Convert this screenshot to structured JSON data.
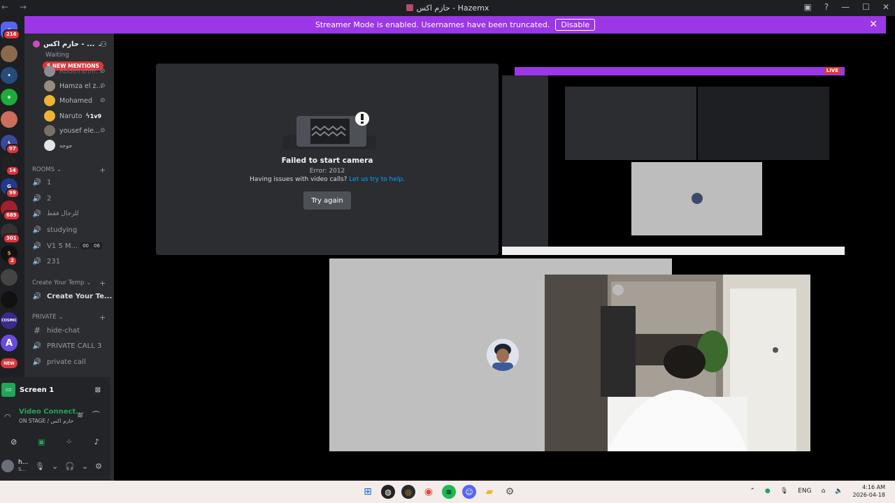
{
  "window": {
    "title": "حازم اكس - Hazemx",
    "nav": "← →"
  },
  "banner": {
    "text": "Streamer Mode is enabled. Usernames have been truncated.",
    "button": "Disable"
  },
  "guild_badges": [
    "216",
    "97",
    "14",
    "99",
    "689",
    "301",
    "2"
  ],
  "guild_labels": {
    "cosmic": "COSMIC",
    "new": "NEW",
    "a": "A",
    "num": "5"
  },
  "server": {
    "name": "حازم اكس - ...",
    "mentions": "5 NEW MENTIONS",
    "waiting": "Waiting"
  },
  "members": [
    {
      "name": "Abdelrahm...",
      "color": "#8a8d93"
    },
    {
      "name": "Hamza el z...",
      "color": "#9a8b7a"
    },
    {
      "name": "Mohamed",
      "color": "#f0b232"
    },
    {
      "name": "Naruto",
      "tag": "1v9",
      "color": "#f0b232"
    },
    {
      "name": "yousef ele...",
      "color": "#7a6f66"
    },
    {
      "name": "جوجه",
      "color": "#e3e5e8"
    }
  ],
  "categories": {
    "rooms": "ROOMS",
    "temp": "Create Your Temp",
    "private": "PRIVATE"
  },
  "channels": [
    {
      "name": "1",
      "icon": "🔊",
      "bold": false
    },
    {
      "name": "2",
      "icon": "🔊",
      "bold": false
    },
    {
      "name": "للرجال فقط",
      "icon": "🔊",
      "bold": false
    },
    {
      "name": "studying",
      "icon": "🔊",
      "bold": false
    },
    {
      "name": "V1 5 M...",
      "icon": "🔊",
      "bold": false,
      "counts": [
        "00",
        "06"
      ]
    },
    {
      "name": "231",
      "icon": "🔊",
      "bold": false
    },
    {
      "name": "Create Your Te...",
      "icon": "🔊",
      "bold": true
    },
    {
      "name": "hide-chat",
      "icon": "#",
      "bold": false
    },
    {
      "name": "PRIVATE CALL 3",
      "icon": "🔊",
      "bold": false
    },
    {
      "name": "private call",
      "icon": "🔊",
      "bold": false
    }
  ],
  "panel": {
    "screen": "Screen 1",
    "vc_title": "Video Connect...",
    "vc_sub": "ON STAGE / حازم اكس",
    "user": "h...",
    "user_sub": "S..."
  },
  "tile_failed": {
    "title": "Failed to start camera",
    "error": "Error: 2012",
    "help_prefix": "Having issues with video calls?",
    "help_link": "Let us try to help.",
    "button": "Try again"
  },
  "nested": {
    "live": "LIVE"
  },
  "tray": {
    "lang": "ENG",
    "time": "4:16 AM",
    "date": "2026-04-18"
  }
}
